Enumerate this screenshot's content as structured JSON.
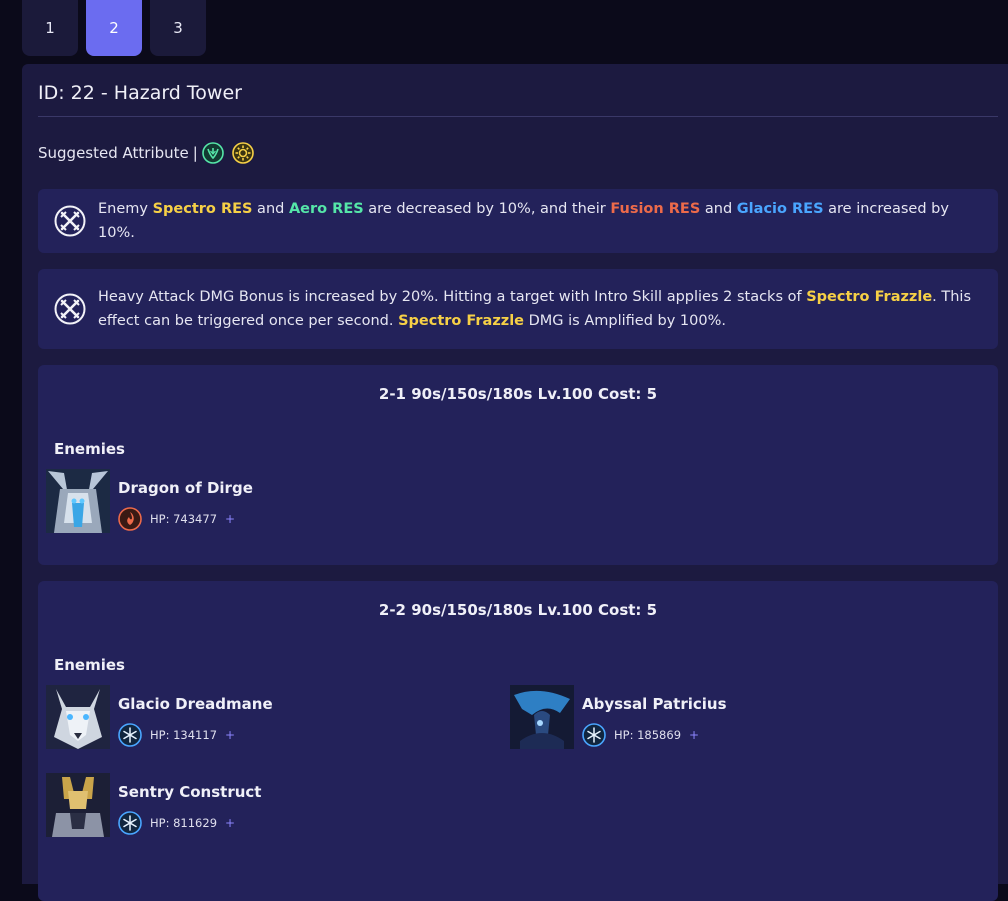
{
  "tabs": [
    {
      "label": "1",
      "active": false
    },
    {
      "label": "2",
      "active": true
    },
    {
      "label": "3",
      "active": false
    }
  ],
  "header": {
    "title": "ID: 22 - Hazard Tower"
  },
  "suggested": {
    "label": "Suggested Attribute",
    "separator": "|",
    "attributes": [
      "aero-icon",
      "spectro-icon"
    ]
  },
  "effects": [
    {
      "icon": "crossed-swords-icon",
      "parts": [
        "Enemy ",
        "Spectro RES",
        " and ",
        "Aero RES",
        " are decreased by 10%, and their ",
        "Fusion RES",
        " and ",
        "Glacio RES",
        " are increased by 10%."
      ]
    },
    {
      "icon": "crossed-swords-icon",
      "parts": [
        "Heavy Attack DMG Bonus is increased by 20%. Hitting a target with Intro Skill applies 2 stacks of ",
        "Spectro Frazzle",
        ". This effect can be triggered once per second. ",
        "Spectro Frazzle",
        " DMG is Amplified by 100%."
      ]
    }
  ],
  "stages": [
    {
      "header": "2-1 90s/150s/180s Lv.100 Cost: 5",
      "enemies_label": "Enemies",
      "enemies": [
        {
          "name": "Dragon of Dirge",
          "hp": "HP: 743477",
          "plus": "+",
          "element": "fusion-icon",
          "portrait": "dragon-portrait"
        }
      ]
    },
    {
      "header": "2-2 90s/150s/180s Lv.100 Cost: 5",
      "enemies_label": "Enemies",
      "enemies": [
        {
          "name": "Glacio Dreadmane",
          "hp": "HP: 134117",
          "plus": "+",
          "element": "glacio-icon",
          "portrait": "wolf-portrait"
        },
        {
          "name": "Abyssal Patricius",
          "hp": "HP: 185869",
          "plus": "+",
          "element": "glacio-icon",
          "portrait": "abyssal-portrait"
        },
        {
          "name": "Sentry Construct",
          "hp": "HP: 811629",
          "plus": "+",
          "element": "glacio-icon",
          "portrait": "construct-portrait"
        }
      ]
    }
  ],
  "colors": {
    "accent": "#6b6cf0",
    "spectro": "#f6d046",
    "aero": "#55e6a8",
    "fusion": "#ec6a4a",
    "glacio": "#4aa6ff"
  }
}
